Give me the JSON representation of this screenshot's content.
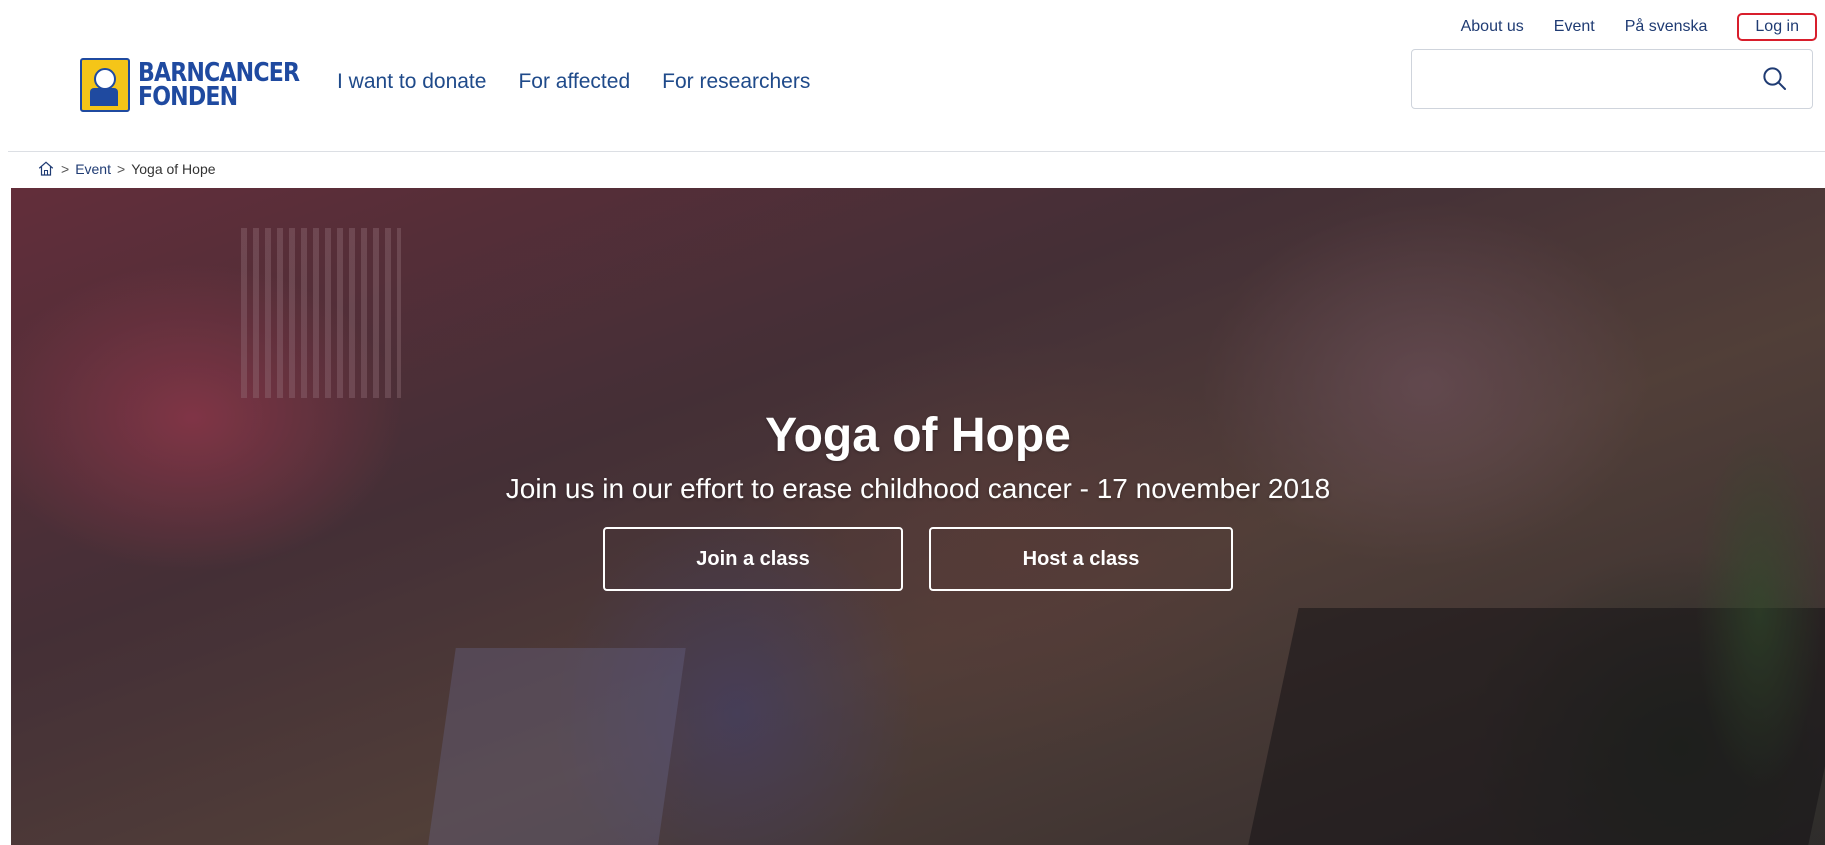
{
  "utility_nav": {
    "about": "About us",
    "event": "Event",
    "swedish": "På svenska",
    "login": "Log in"
  },
  "logo": {
    "line1": "BARNCANCER",
    "line2": "FONDEN"
  },
  "main_nav": {
    "donate": "I want to donate",
    "affected": "For affected",
    "researchers": "For researchers"
  },
  "search": {
    "value": "",
    "icon": "search-icon"
  },
  "breadcrumb": {
    "home_icon": "home-icon",
    "separator": ">",
    "event": "Event",
    "current": "Yoga of Hope"
  },
  "hero": {
    "title": "Yoga of Hope",
    "subtitle": "Join us in our effort to erase childhood cancer - 17 november 2018",
    "join_label": "Join a class",
    "host_label": "Host a class"
  },
  "colors": {
    "brand_blue": "#1f3b73",
    "highlight_red": "#d81e2c",
    "logo_yellow": "#f5c518"
  }
}
